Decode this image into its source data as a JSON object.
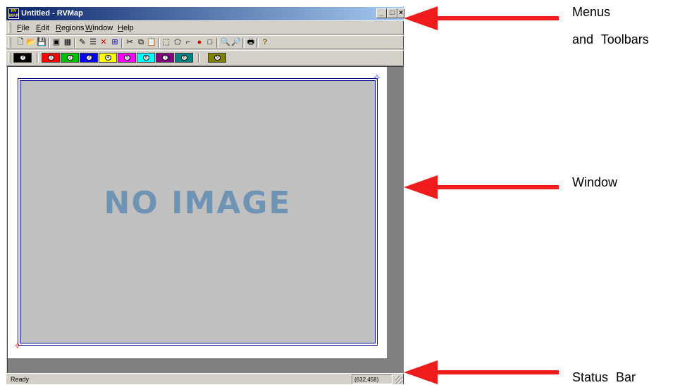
{
  "window": {
    "title": "Untitled - RVMap",
    "app_icon_text": "RV MAP",
    "controls": {
      "minimize": "_",
      "maximize": "□",
      "close": "×"
    }
  },
  "menubar": {
    "items": [
      {
        "label": "File"
      },
      {
        "label": "Edit"
      },
      {
        "label": "Regions"
      },
      {
        "label": "Window"
      },
      {
        "label": "Help"
      }
    ]
  },
  "toolbar": {
    "buttons": [
      {
        "name": "new-icon",
        "glyph": "🗋"
      },
      {
        "name": "open-icon",
        "glyph": "📂"
      },
      {
        "name": "save-icon",
        "glyph": "💾"
      },
      {
        "name": "view-image-icon",
        "glyph": "▣"
      },
      {
        "name": "grid-icon",
        "glyph": "▦"
      },
      {
        "name": "region-tool-icon",
        "glyph": "✎"
      },
      {
        "name": "region-list-icon",
        "glyph": "☰"
      },
      {
        "name": "delete-icon",
        "glyph": "✕"
      },
      {
        "name": "select-region-icon",
        "glyph": "⊞"
      },
      {
        "name": "cut-icon",
        "glyph": "✂"
      },
      {
        "name": "copy-icon",
        "glyph": "⧉"
      },
      {
        "name": "paste-icon",
        "glyph": "📋"
      },
      {
        "name": "rectangle-icon",
        "glyph": "⬚"
      },
      {
        "name": "polygon-icon",
        "glyph": "⬠"
      },
      {
        "name": "polyline-icon",
        "glyph": "⌐"
      },
      {
        "name": "circle-icon",
        "glyph": "●"
      },
      {
        "name": "square-icon",
        "glyph": "□"
      },
      {
        "name": "zoom-in-icon",
        "glyph": "🔍"
      },
      {
        "name": "zoom-out-icon",
        "glyph": "🔎"
      },
      {
        "name": "print-icon",
        "glyph": "🖶"
      },
      {
        "name": "help-icon",
        "glyph": "?"
      }
    ]
  },
  "region_toolbar": {
    "buttons": [
      {
        "label": "0",
        "color": "#000000"
      },
      {
        "label": "1",
        "color": "#ff0000"
      },
      {
        "label": "2",
        "color": "#00c000"
      },
      {
        "label": "3",
        "color": "#0000ff"
      },
      {
        "label": "4",
        "color": "#ffff00"
      },
      {
        "label": "5",
        "color": "#ff00ff"
      },
      {
        "label": "6",
        "color": "#00ffff"
      },
      {
        "label": "7",
        "color": "#800080"
      },
      {
        "label": "8",
        "color": "#008080"
      },
      {
        "label": "9",
        "color": "#808000"
      }
    ]
  },
  "document": {
    "placeholder_text": "NO IMAGE"
  },
  "statusbar": {
    "text": "Ready",
    "coordinates": "(632,458)"
  },
  "annotations": {
    "menus_line1": "Menus",
    "menus_line2": "and Toolbars",
    "window": "Window",
    "status_bar": "Status Bar",
    "arrow_color": "#ee1c1c"
  }
}
